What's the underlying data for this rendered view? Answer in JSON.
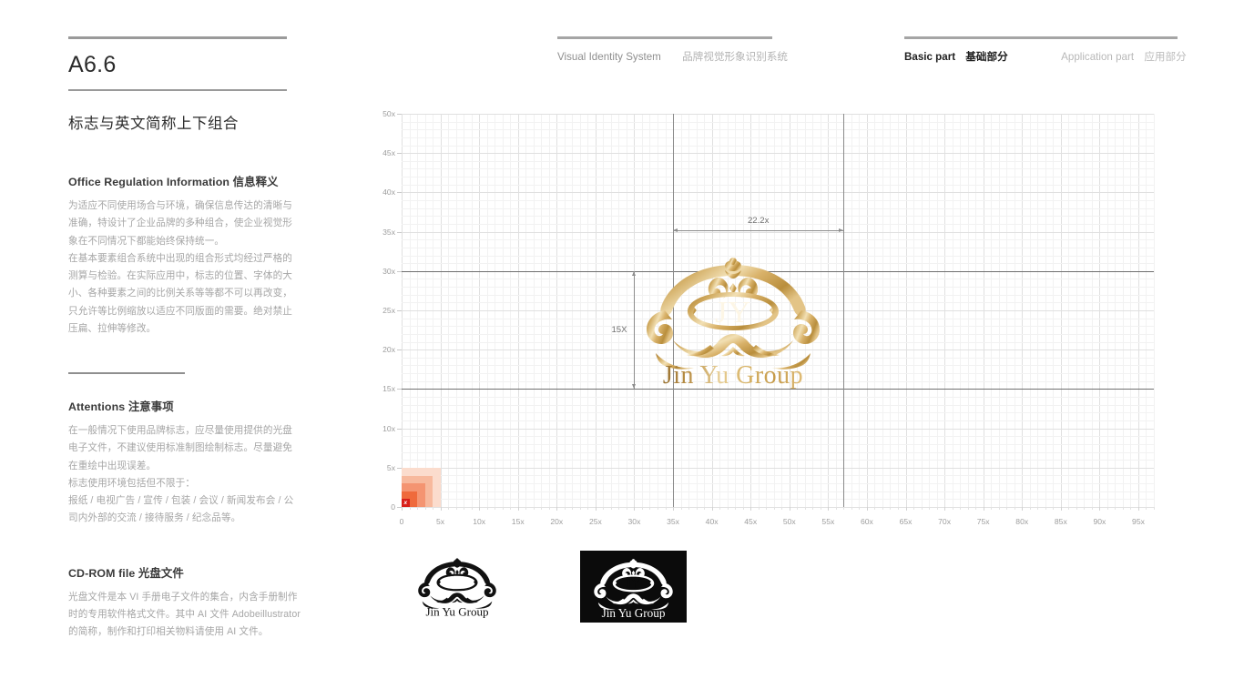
{
  "page": {
    "code": "A6.6",
    "section_title": "标志与英文简称上下组合"
  },
  "header": {
    "group_left": {
      "en": "Visual Identity System",
      "cn": "品牌视觉形象识别系统"
    },
    "group_right": {
      "basic_en": "Basic part",
      "basic_cn": "基础部分",
      "application_en": "Application part",
      "application_cn": "应用部分"
    }
  },
  "blocks": [
    {
      "heading_en": "Office Regulation Information",
      "heading_cn": "信息释义",
      "paragraphs": [
        "为适应不同使用场合与环境，确保信息传达的清晰与准确，特设计了企业品牌的多种组合，使企业视觉形象在不同情况下都能始终保持统一。",
        "在基本要素组合系统中出现的组合形式均经过严格的测算与检验。在实际应用中，标志的位置、字体的大小、各种要素之间的比例关系等等都不可以再改变，只允许等比例缩放以适应不同版面的需要。绝对禁止压扁、拉伸等修改。"
      ]
    },
    {
      "heading_en": "Attentions",
      "heading_cn": "注意事项",
      "paragraphs": [
        "在一般情况下使用品牌标志，应尽量使用提供的光盘电子文件，不建议使用标准制图绘制标志。尽量避免在重绘中出现误差。",
        "标志使用环境包括但不限于：",
        "报纸 / 电视广告 / 宣传 / 包装 / 会议 / 新闻发布会 / 公司内外部的交流 / 接待服务 / 纪念品等。"
      ]
    },
    {
      "heading_en": "CD-ROM file",
      "heading_cn": "光盘文件",
      "paragraphs": [
        "光盘文件是本 VI 手册电子文件的集合，内含手册制作时的专用软件格式文件。其中 AI 文件 Adobeillustrator 的简称，制作和打印相关物料请使用 AI 文件。"
      ]
    }
  ],
  "logo": {
    "monogram": "JY",
    "wordmark": "Jin Yu Group",
    "gold_dark": "#b08535",
    "gold_light": "#f0d9a8"
  },
  "chart_data": {
    "type": "grid",
    "title": "",
    "xlabel": "",
    "ylabel": "",
    "xlim": [
      0,
      97
    ],
    "ylim": [
      0,
      50
    ],
    "x_ticks": [
      "0",
      "5x",
      "10x",
      "15x",
      "20x",
      "25x",
      "30x",
      "35x",
      "40x",
      "45x",
      "50x",
      "55x",
      "60x",
      "65x",
      "70x",
      "75x",
      "80x",
      "85x",
      "90x",
      "95x"
    ],
    "x_tick_values": [
      0,
      5,
      10,
      15,
      20,
      25,
      30,
      35,
      40,
      45,
      50,
      55,
      60,
      65,
      70,
      75,
      80,
      85,
      90,
      95
    ],
    "y_ticks": [
      "0",
      "5x",
      "10x",
      "15x",
      "20x",
      "25x",
      "30x",
      "35x",
      "40x",
      "45x",
      "50x"
    ],
    "y_tick_values": [
      0,
      5,
      10,
      15,
      20,
      25,
      30,
      35,
      40,
      45,
      50
    ],
    "grid": true,
    "minor_step": 1,
    "major_step": 5,
    "reference_lines_y": [
      15,
      30
    ],
    "guide_lines_x": [
      35,
      57
    ],
    "annotations": [
      {
        "label": "22.2x",
        "type": "horizontal-dimension",
        "from_x": 35,
        "to_x": 57,
        "at_y": 35.2
      },
      {
        "label": "15X",
        "type": "vertical-dimension",
        "from_y": 15,
        "to_y": 30,
        "at_x": 30
      }
    ],
    "unit_swatch": {
      "label": "x",
      "steps": [
        {
          "size": 5,
          "color": "#fbdccd"
        },
        {
          "size": 4,
          "color": "#f7b99d"
        },
        {
          "size": 3,
          "color": "#f49471"
        },
        {
          "size": 2,
          "color": "#ef6a3c"
        },
        {
          "size": 1,
          "color": "#d8201b"
        }
      ]
    },
    "logo_placement": {
      "x_from": 35,
      "x_to": 57,
      "y_from": 15,
      "y_to": 30
    }
  },
  "variants": [
    {
      "name": "black-on-white",
      "wordmark": "Jin Yu Group",
      "fg": "#111111",
      "bg": "#ffffff"
    },
    {
      "name": "white-on-black",
      "wordmark": "Jin Yu Group",
      "fg": "#ffffff",
      "bg": "#0b0b0b"
    }
  ]
}
